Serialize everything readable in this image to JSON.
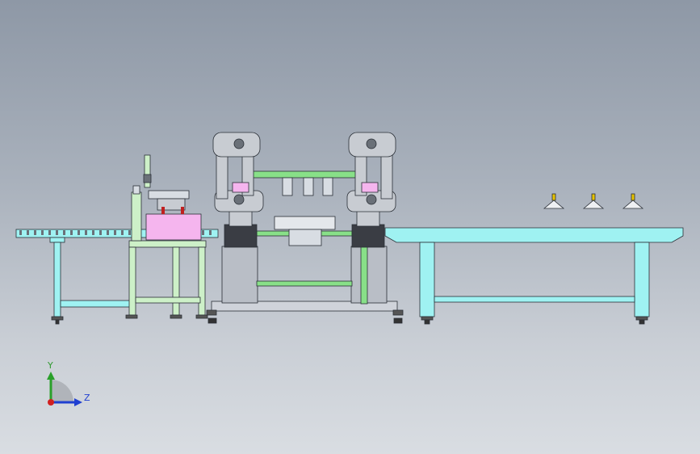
{
  "viewport": {
    "background_top": "#8e98a6",
    "background_bottom": "#d9dde2"
  },
  "colors": {
    "conveyor_frame": "#9ff2f2",
    "workbench_frame": "#cdf0c8",
    "table_frame": "#9ff2f2",
    "robot_body": "#c8ccd2",
    "robot_dark": "#3a3d44",
    "gantry": "#88e088",
    "pink_box": "#f5b5ee",
    "edge": "#2a2f36"
  },
  "triad": {
    "y_label": "Y",
    "z_label": "Z",
    "y_color": "#2aa02a",
    "z_color": "#1f3fd1",
    "x_color": "#d12020"
  }
}
